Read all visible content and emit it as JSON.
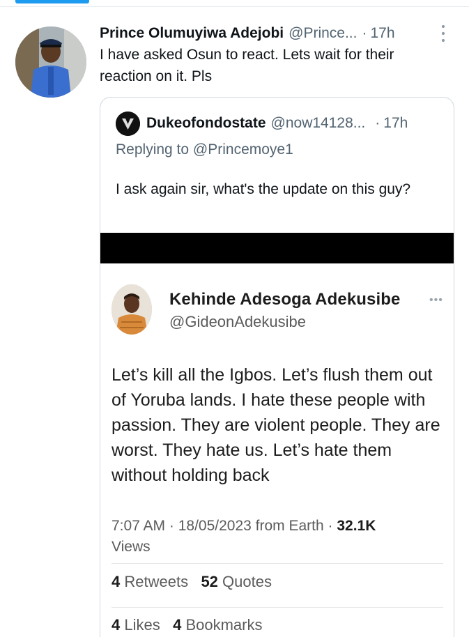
{
  "colors": {
    "accent": "#1d9bf0",
    "text_primary": "#0f1419",
    "text_secondary": "#536471",
    "border": "#cfd9de"
  },
  "tweet": {
    "author_name": "Prince Olumuyiwa Adejobi",
    "author_handle": "@Prince...",
    "separator": "·",
    "time": "17h",
    "avatar_icon": "police-officer-avatar",
    "more_icon": "more-vertical-icon",
    "text": "I have asked Osun to react. Lets wait for their reaction on it. Pls"
  },
  "quoted": {
    "author_name": "Dukeofondostate",
    "author_handle": "@now14128...",
    "separator": "·",
    "time": "17h",
    "avatar_icon": "black-logo-avatar",
    "replying_prefix": "Replying to",
    "replying_handle": "@Princemoye1",
    "text": "I ask again sir, what's the update on this guy?"
  },
  "embedded_screenshot": {
    "author_name": "Kehinde Adesoga Adekusibe",
    "author_handle": "@GideonAdekusibe",
    "more_icon": "more-horizontal-icon",
    "text": "Let’s kill all the Igbos. Let’s flush them out of Yoruba lands. I hate these people with passion. They are violent people. They are worst. They hate us. Let’s hate them without holding back",
    "meta": "7:07 AM · 18/05/2023 from Earth ·",
    "views_count": "32.1K",
    "views_label": "Views",
    "retweets_count": "4",
    "retweets_label": "Retweets",
    "quotes_count": "52",
    "quotes_label": "Quotes",
    "likes_count": "4",
    "likes_label": "Likes",
    "bookmarks_count": "4",
    "bookmarks_label": "Bookmarks"
  }
}
